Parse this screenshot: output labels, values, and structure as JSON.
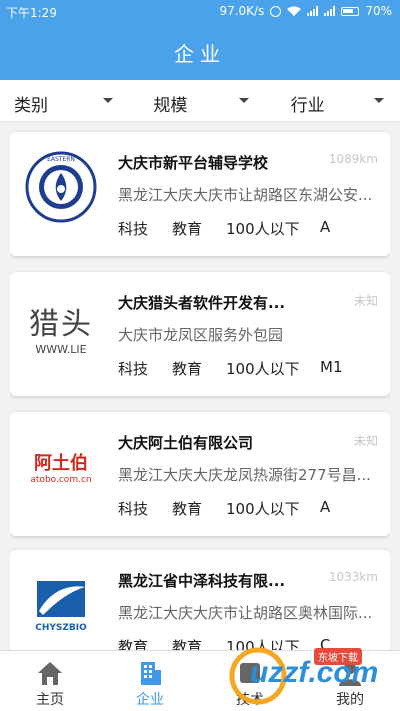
{
  "status_bar": {
    "time": "下午1:29",
    "network_speed": "97.0K/s",
    "battery": "70%"
  },
  "app_bar": {
    "title": "企业"
  },
  "filters": [
    {
      "label": "类别"
    },
    {
      "label": "规模"
    },
    {
      "label": "行业"
    }
  ],
  "companies": [
    {
      "name": "大庆市新平台辅导学校",
      "distance": "1089km",
      "address": "黑龙江大庆大庆市让胡路区东湖公安...",
      "tags": [
        "科技",
        "教育",
        "100人以下",
        "A"
      ],
      "logo_icon": "school-seal-logo"
    },
    {
      "name": "大庆猎头者软件开发有...",
      "distance": "未知",
      "address": "大庆市龙凤区服务外包园",
      "tags": [
        "科技",
        "教育",
        "100人以下",
        "M1"
      ],
      "logo_icon": "liete-logo",
      "logo_text": "猎头",
      "logo_subtext": "WWW.LIE"
    },
    {
      "name": "大庆阿土伯有限公司",
      "distance": "未知",
      "address": "黑龙江大庆大庆龙凤热源街277号昌...",
      "tags": [
        "科技",
        "教育",
        "100人以下",
        "A"
      ],
      "logo_icon": "atobo-logo",
      "logo_text": "阿土伯",
      "logo_subtext": "atobo.com.cn"
    },
    {
      "name": "黑龙江省中泽科技有限...",
      "distance": "1033km",
      "address": "黑龙江大庆大庆市让胡路区奥林国际...",
      "tags": [
        "教育",
        "教育",
        "100人以下",
        "C"
      ],
      "logo_icon": "chyszbio-logo",
      "logo_text": "CHYSZBIO"
    }
  ],
  "tab_bar": [
    {
      "label": "主页",
      "icon": "home-icon"
    },
    {
      "label": "企业",
      "icon": "building-icon",
      "active": true
    },
    {
      "label": "技术",
      "icon": "tech-icon"
    },
    {
      "label": "我的",
      "icon": "user-icon"
    }
  ],
  "watermark": {
    "text": "uzzf.com",
    "badge": "东坡下载"
  },
  "colors": {
    "primary": "#4aa3ea",
    "active_tab": "#3d9be9",
    "background": "#f2f2f2"
  }
}
